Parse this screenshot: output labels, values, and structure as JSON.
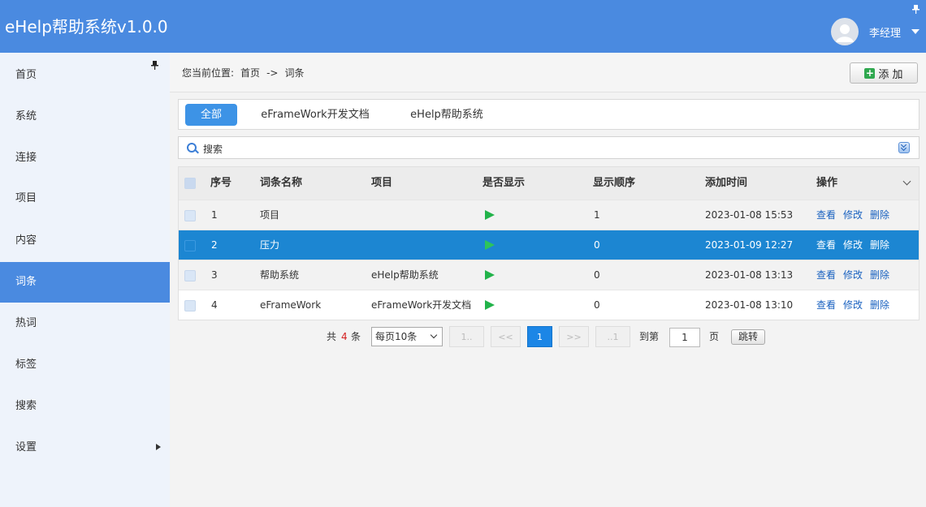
{
  "app": {
    "title": "eHelp帮助系统v1.0.0"
  },
  "user": {
    "name": "李经理"
  },
  "sidebar": {
    "items": [
      {
        "label": "首页"
      },
      {
        "label": "系统"
      },
      {
        "label": "连接"
      },
      {
        "label": "项目"
      },
      {
        "label": "内容"
      },
      {
        "label": "词条"
      },
      {
        "label": "热词"
      },
      {
        "label": "标签"
      },
      {
        "label": "搜索"
      },
      {
        "label": "设置"
      }
    ],
    "active": "词条"
  },
  "breadcrumb": {
    "prefix": "您当前位置:",
    "home": "首页",
    "sep": "->",
    "current": "词条"
  },
  "toolbar": {
    "add_label": "添 加"
  },
  "tabs": [
    {
      "label": "全部",
      "active": true
    },
    {
      "label": "eFrameWork开发文档",
      "active": false
    },
    {
      "label": "eHelp帮助系统",
      "active": false
    }
  ],
  "search": {
    "label": "搜索"
  },
  "table": {
    "columns": [
      "序号",
      "词条名称",
      "项目",
      "是否显示",
      "显示顺序",
      "添加时间",
      "操作"
    ],
    "rows": [
      {
        "no": "1",
        "name": "项目",
        "project": "",
        "shown": true,
        "order": "1",
        "time": "2023-01-08 15:53"
      },
      {
        "no": "2",
        "name": "压力",
        "project": "",
        "shown": true,
        "order": "0",
        "time": "2023-01-09 12:27",
        "selected": true
      },
      {
        "no": "3",
        "name": "帮助系统",
        "project": "eHelp帮助系统",
        "shown": true,
        "order": "0",
        "time": "2023-01-08 13:13"
      },
      {
        "no": "4",
        "name": "eFrameWork",
        "project": "eFrameWork开发文档",
        "shown": true,
        "order": "0",
        "time": "2023-01-08 13:10"
      }
    ],
    "actions": [
      "查看",
      "修改",
      "删除"
    ]
  },
  "pager": {
    "total_prefix": "共",
    "total": "4",
    "total_suffix": "条",
    "page_size": "每页10条",
    "first": "1..",
    "prev": "<<",
    "current": "1",
    "next": ">>",
    "last": "..1",
    "goto_label": "到第",
    "goto_value": "1",
    "page_unit": "页",
    "jump_label": "跳转"
  },
  "colors": {
    "header": "#4a8ae0",
    "selected_row": "#1c86d2",
    "shown_icon": "#22b34a",
    "link": "#1a62c0"
  }
}
